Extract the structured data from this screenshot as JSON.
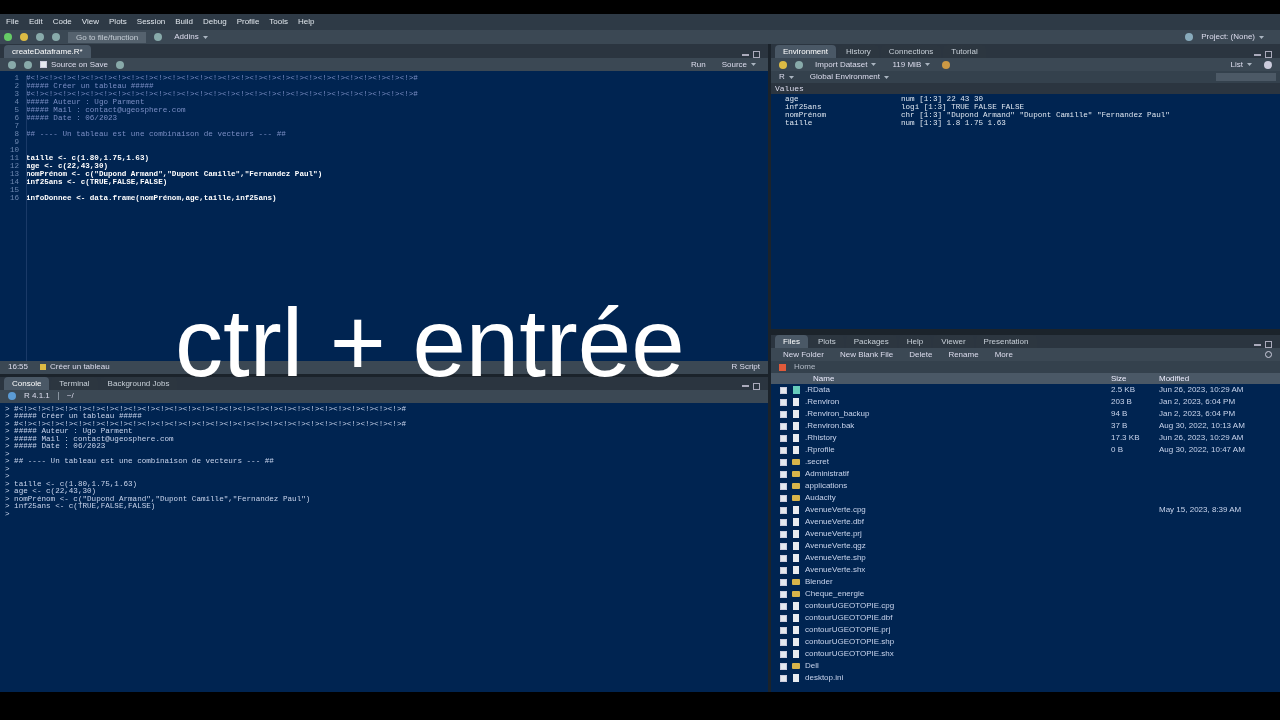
{
  "menu": [
    "File",
    "Edit",
    "Code",
    "View",
    "Plots",
    "Session",
    "Build",
    "Debug",
    "Profile",
    "Tools",
    "Help"
  ],
  "toolbar": {
    "goto": "Go to file/function",
    "addins": "Addins",
    "project": "Project: (None)"
  },
  "editor": {
    "tabs": [
      {
        "label": "createDataframe.R*",
        "selected": true
      }
    ],
    "toolbar": {
      "source_on_save": "Source on Save",
      "source_on_save_checked": false,
      "run": "Run",
      "source": "Source"
    },
    "lines": [
      {
        "n": "1",
        "kind": "comment",
        "text": "#<!><!><!><!><!><!><!><!><!><!><!><!><!><!><!><!><!><!><!><!><!><!><!><!><!><!><!><!>#"
      },
      {
        "n": "2",
        "kind": "comment",
        "text": "##### Créer un tableau #####"
      },
      {
        "n": "3",
        "kind": "comment",
        "text": "#<!><!><!><!><!><!><!><!><!><!><!><!><!><!><!><!><!><!><!><!><!><!><!><!><!><!><!><!>#"
      },
      {
        "n": "4",
        "kind": "comment",
        "text": "##### Auteur : Ugo Parment"
      },
      {
        "n": "5",
        "kind": "comment",
        "text": "##### Mail : contact@ugeosphere.com"
      },
      {
        "n": "6",
        "kind": "comment",
        "text": "##### Date : 06/2023"
      },
      {
        "n": "7"
      },
      {
        "n": "8",
        "kind": "comment",
        "text": "## ---- Un tableau est une combinaison de vecteurs --- ##"
      },
      {
        "n": "9"
      },
      {
        "n": "10"
      },
      {
        "n": "11",
        "kind": "code",
        "text": "taille <- c(1.80,1.75,1.63)"
      },
      {
        "n": "12",
        "kind": "code",
        "text": "age <- c(22,43,30)"
      },
      {
        "n": "13",
        "kind": "code",
        "text": "nomPrénom <- c(\"Dupond Armand\",\"Dupont Camille\",\"Fernandez Paul\")"
      },
      {
        "n": "14",
        "kind": "code",
        "text": "inf25ans <- c(TRUE,FALSE,FALSE)"
      },
      {
        "n": "15"
      },
      {
        "n": "16",
        "kind": "code",
        "text": "infoDonnee <- data.frame(nomPrénom,age,taille,inf25ans)"
      }
    ],
    "caption": "ctrl + entrée",
    "status": {
      "position": "16:55",
      "section": "Créer un tableau",
      "type": "R Script"
    }
  },
  "console": {
    "tabs": [
      {
        "label": "Console",
        "selected": true
      },
      {
        "label": "Terminal",
        "selected": false
      },
      {
        "label": "Background Jobs",
        "selected": false
      }
    ],
    "version": "R 4.1.1",
    "directory": "~/",
    "lines": [
      "> #<!><!><!><!><!><!><!><!><!><!><!><!><!><!><!><!><!><!><!><!><!><!><!><!><!><!><!><!>#",
      "> ##### Créer un tableau #####",
      "> #<!><!><!><!><!><!><!><!><!><!><!><!><!><!><!><!><!><!><!><!><!><!><!><!><!><!><!><!>#",
      "> ##### Auteur : Ugo Parment",
      "> ##### Mail : contact@ugeosphere.com",
      "> ##### Date : 06/2023",
      ">",
      "> ## ---- Un tableau est une combinaison de vecteurs --- ##",
      ">",
      ">",
      "> taille <- c(1.80,1.75,1.63)",
      "> age <- c(22,43,30)",
      "> nomPrénom <- c(\"Dupond Armand\",\"Dupont Camille\",\"Fernandez Paul\")",
      "> inf25ans <- c(TRUE,FALSE,FALSE)",
      ">"
    ]
  },
  "environment": {
    "tabs": [
      {
        "label": "Environment",
        "selected": true
      },
      {
        "label": "History",
        "selected": false
      },
      {
        "label": "Connections",
        "selected": false
      },
      {
        "label": "Tutorial",
        "selected": false
      }
    ],
    "toolbar": {
      "import": "Import Dataset",
      "memory": "119 MiB",
      "view": "List",
      "language": "R",
      "scope": "Global Environment"
    },
    "section": "Values",
    "values": [
      {
        "name": "age",
        "value": "num [1:3] 22 43 30"
      },
      {
        "name": "inf25ans",
        "value": "logi [1:3] TRUE FALSE FALSE"
      },
      {
        "name": "nomPrénom",
        "value": "chr [1:3] \"Dupond Armand\" \"Dupont Camille\" \"Fernandez Paul\""
      },
      {
        "name": "taille",
        "value": "num [1:3] 1.8 1.75 1.63"
      }
    ]
  },
  "files": {
    "tabs": [
      {
        "label": "Files",
        "selected": true
      },
      {
        "label": "Plots",
        "selected": false
      },
      {
        "label": "Packages",
        "selected": false
      },
      {
        "label": "Help",
        "selected": false
      },
      {
        "label": "Viewer",
        "selected": false
      },
      {
        "label": "Presentation",
        "selected": false
      }
    ],
    "toolbar": [
      "New Folder",
      "New Blank File",
      "Delete",
      "Rename",
      "More"
    ],
    "path": "Home",
    "columns": [
      "Name",
      "Size",
      "Modified"
    ],
    "rows": [
      {
        "kind": "data",
        "name": ".RData",
        "size": "2.5 KB",
        "modified": "Jun 26, 2023, 10:29 AM",
        "checked": false
      },
      {
        "kind": "file",
        "name": ".Renviron",
        "size": "203 B",
        "modified": "Jan 2, 2023, 6:04 PM",
        "checked": false
      },
      {
        "kind": "file",
        "name": ".Renviron_backup",
        "size": "94 B",
        "modified": "Jan 2, 2023, 6:04 PM",
        "checked": false
      },
      {
        "kind": "file",
        "name": ".Renviron.bak",
        "size": "37 B",
        "modified": "Aug 30, 2022, 10:13 AM",
        "checked": false
      },
      {
        "kind": "file",
        "name": ".Rhistory",
        "size": "17.3 KB",
        "modified": "Jun 26, 2023, 10:29 AM",
        "checked": false
      },
      {
        "kind": "file",
        "name": ".Rprofile",
        "size": "0 B",
        "modified": "Aug 30, 2022, 10:47 AM",
        "checked": false
      },
      {
        "kind": "folder",
        "name": ".secret",
        "checked": false
      },
      {
        "kind": "folder",
        "name": "Administratif",
        "checked": false
      },
      {
        "kind": "folder",
        "name": "applications",
        "checked": false
      },
      {
        "kind": "folder",
        "name": "Audacity",
        "checked": false
      },
      {
        "kind": "file",
        "name": "AvenueVerte.cpg",
        "modified": "May 15, 2023, 8:39 AM",
        "checked": false
      },
      {
        "kind": "file",
        "name": "AvenueVerte.dbf",
        "checked": false
      },
      {
        "kind": "file",
        "name": "AvenueVerte.prj",
        "checked": false
      },
      {
        "kind": "file",
        "name": "AvenueVerte.qgz",
        "checked": false
      },
      {
        "kind": "file",
        "name": "AvenueVerte.shp",
        "checked": false
      },
      {
        "kind": "file",
        "name": "AvenueVerte.shx",
        "checked": false
      },
      {
        "kind": "folder",
        "name": "Blender",
        "checked": false
      },
      {
        "kind": "folder",
        "name": "Cheque_energie",
        "checked": false
      },
      {
        "kind": "file",
        "name": "contourUGEOTOPIE.cpg",
        "checked": false
      },
      {
        "kind": "file",
        "name": "contourUGEOTOPIE.dbf",
        "checked": false
      },
      {
        "kind": "file",
        "name": "contourUGEOTOPIE.prj",
        "checked": false
      },
      {
        "kind": "file",
        "name": "contourUGEOTOPIE.shp",
        "checked": false
      },
      {
        "kind": "file",
        "name": "contourUGEOTOPIE.shx",
        "checked": false
      },
      {
        "kind": "folder",
        "name": "Dell",
        "checked": false
      },
      {
        "kind": "file",
        "name": "desktop.ini",
        "checked": false
      }
    ]
  }
}
